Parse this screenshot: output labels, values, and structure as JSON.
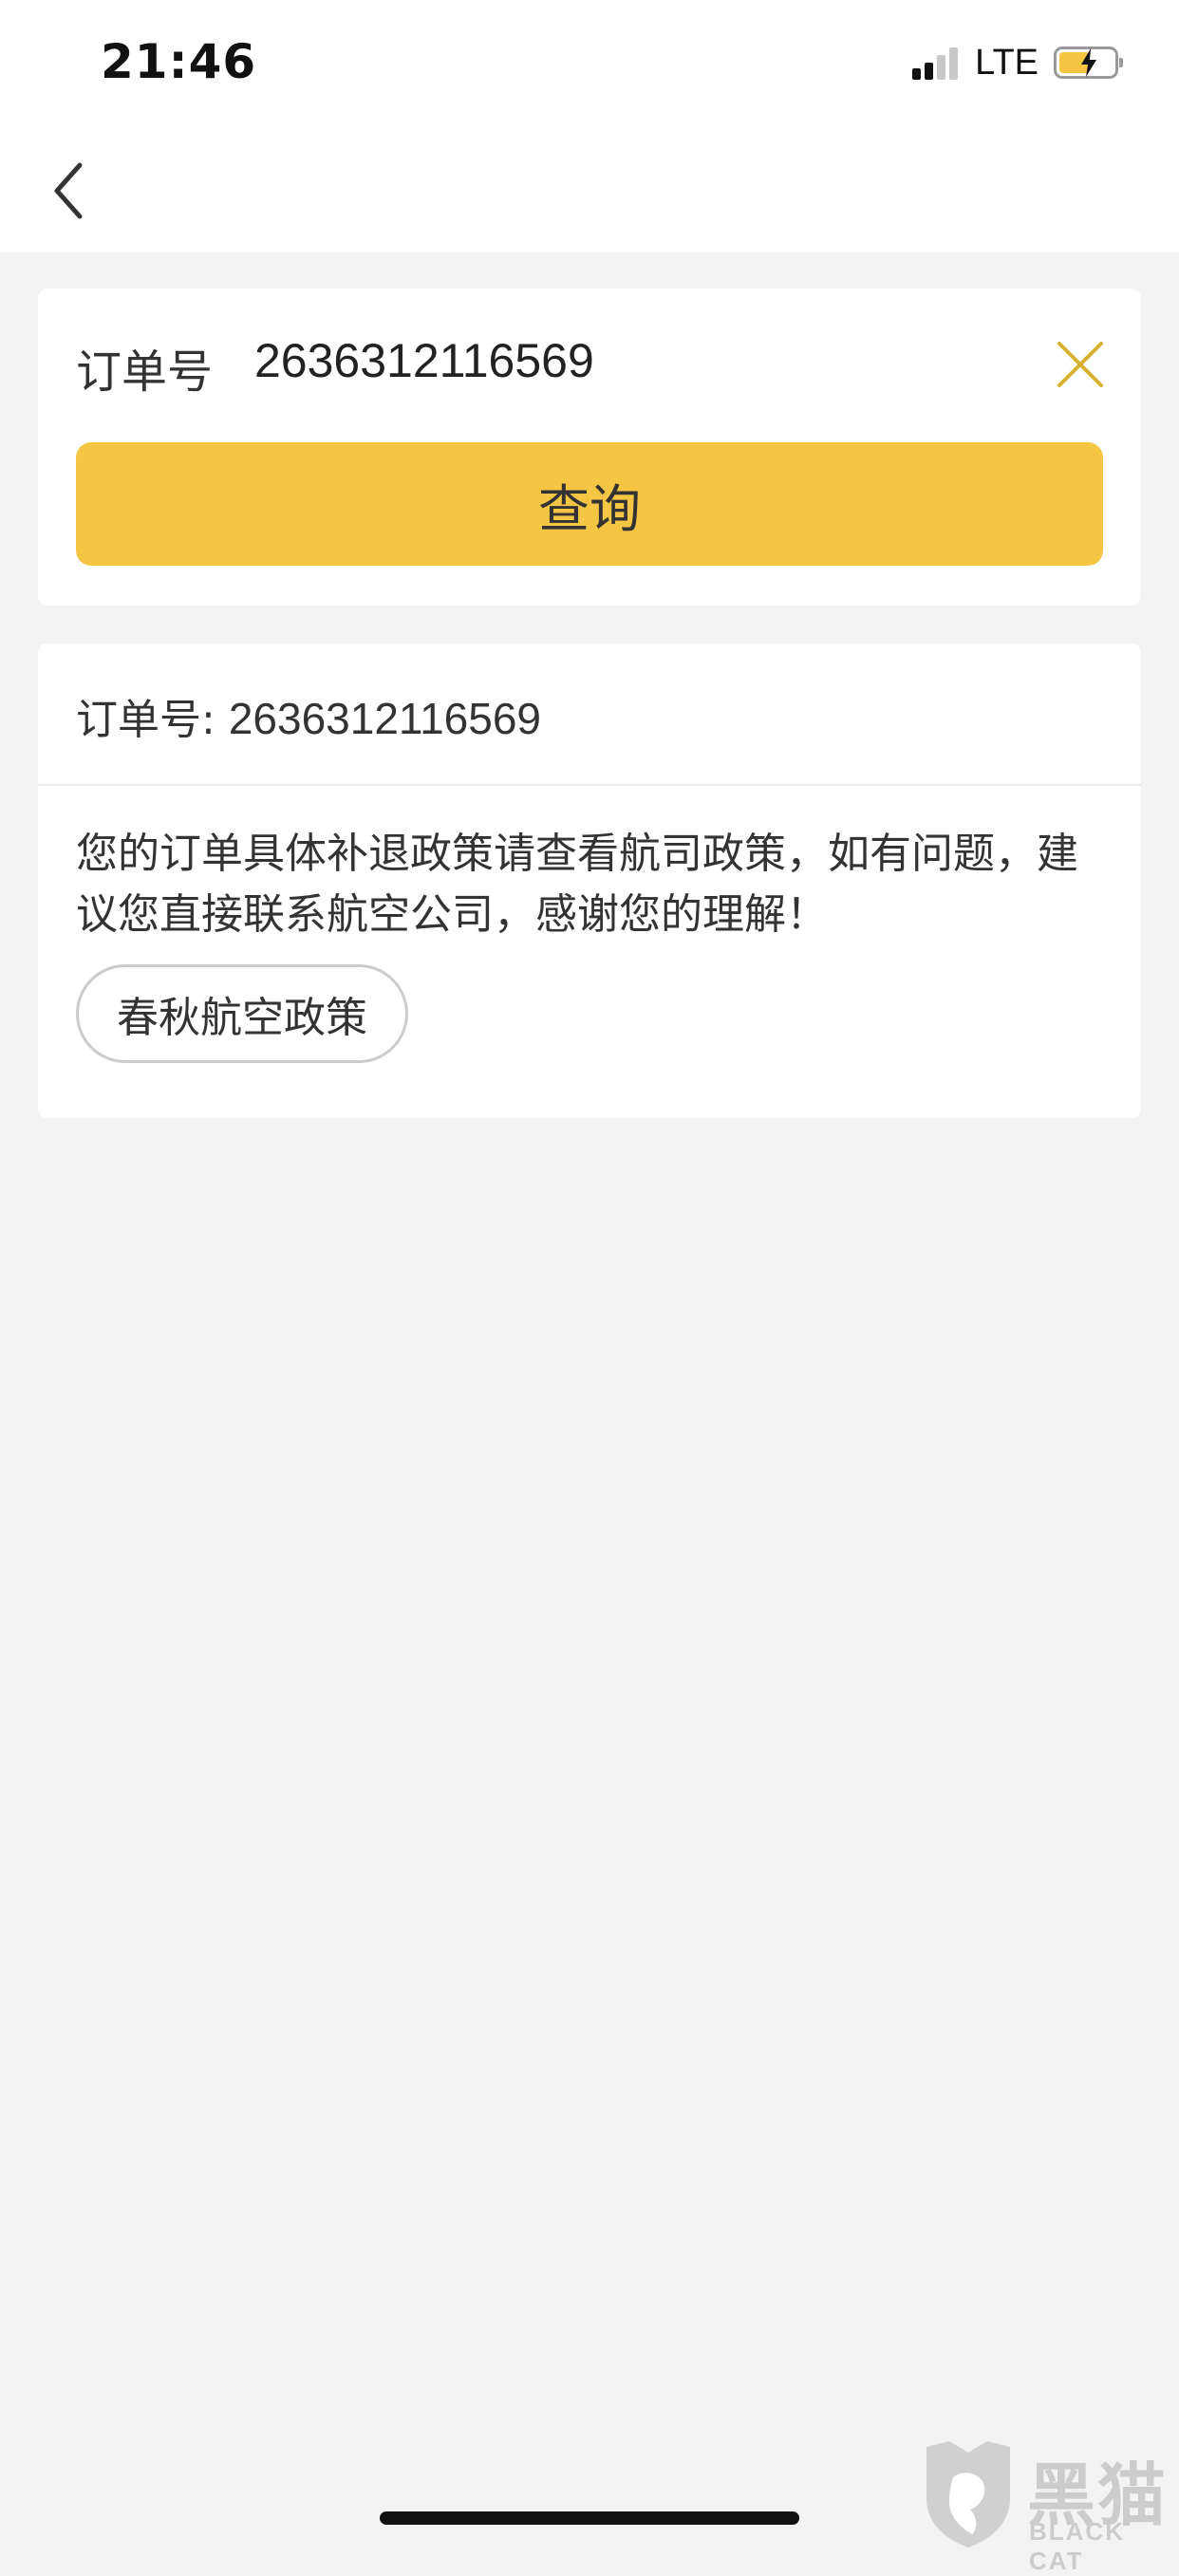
{
  "status_bar": {
    "time": "21:46",
    "network": "LTE",
    "signal_bars_active": 2,
    "signal_bars_total": 4,
    "battery_icon": "battery-charging-icon"
  },
  "nav": {
    "back_icon": "chevron-left-icon"
  },
  "search": {
    "label": "订单号",
    "value": "2636312116569",
    "clear_icon": "close-icon",
    "query_label": "查询"
  },
  "result": {
    "order_label": "订单号:",
    "order_number": "2636312116569",
    "policy_text": "您的订单具体补退政策请查看航司政策，如有问题，建议您直接联系航空公司，感谢您的理解！",
    "policy_button": "春秋航空政策"
  },
  "watermark": {
    "cn": "黑猫",
    "en": "BLACK CAT"
  },
  "colors": {
    "accent": "#f5c544",
    "clear_icon": "#d9b233",
    "background": "#f3f3f3"
  }
}
